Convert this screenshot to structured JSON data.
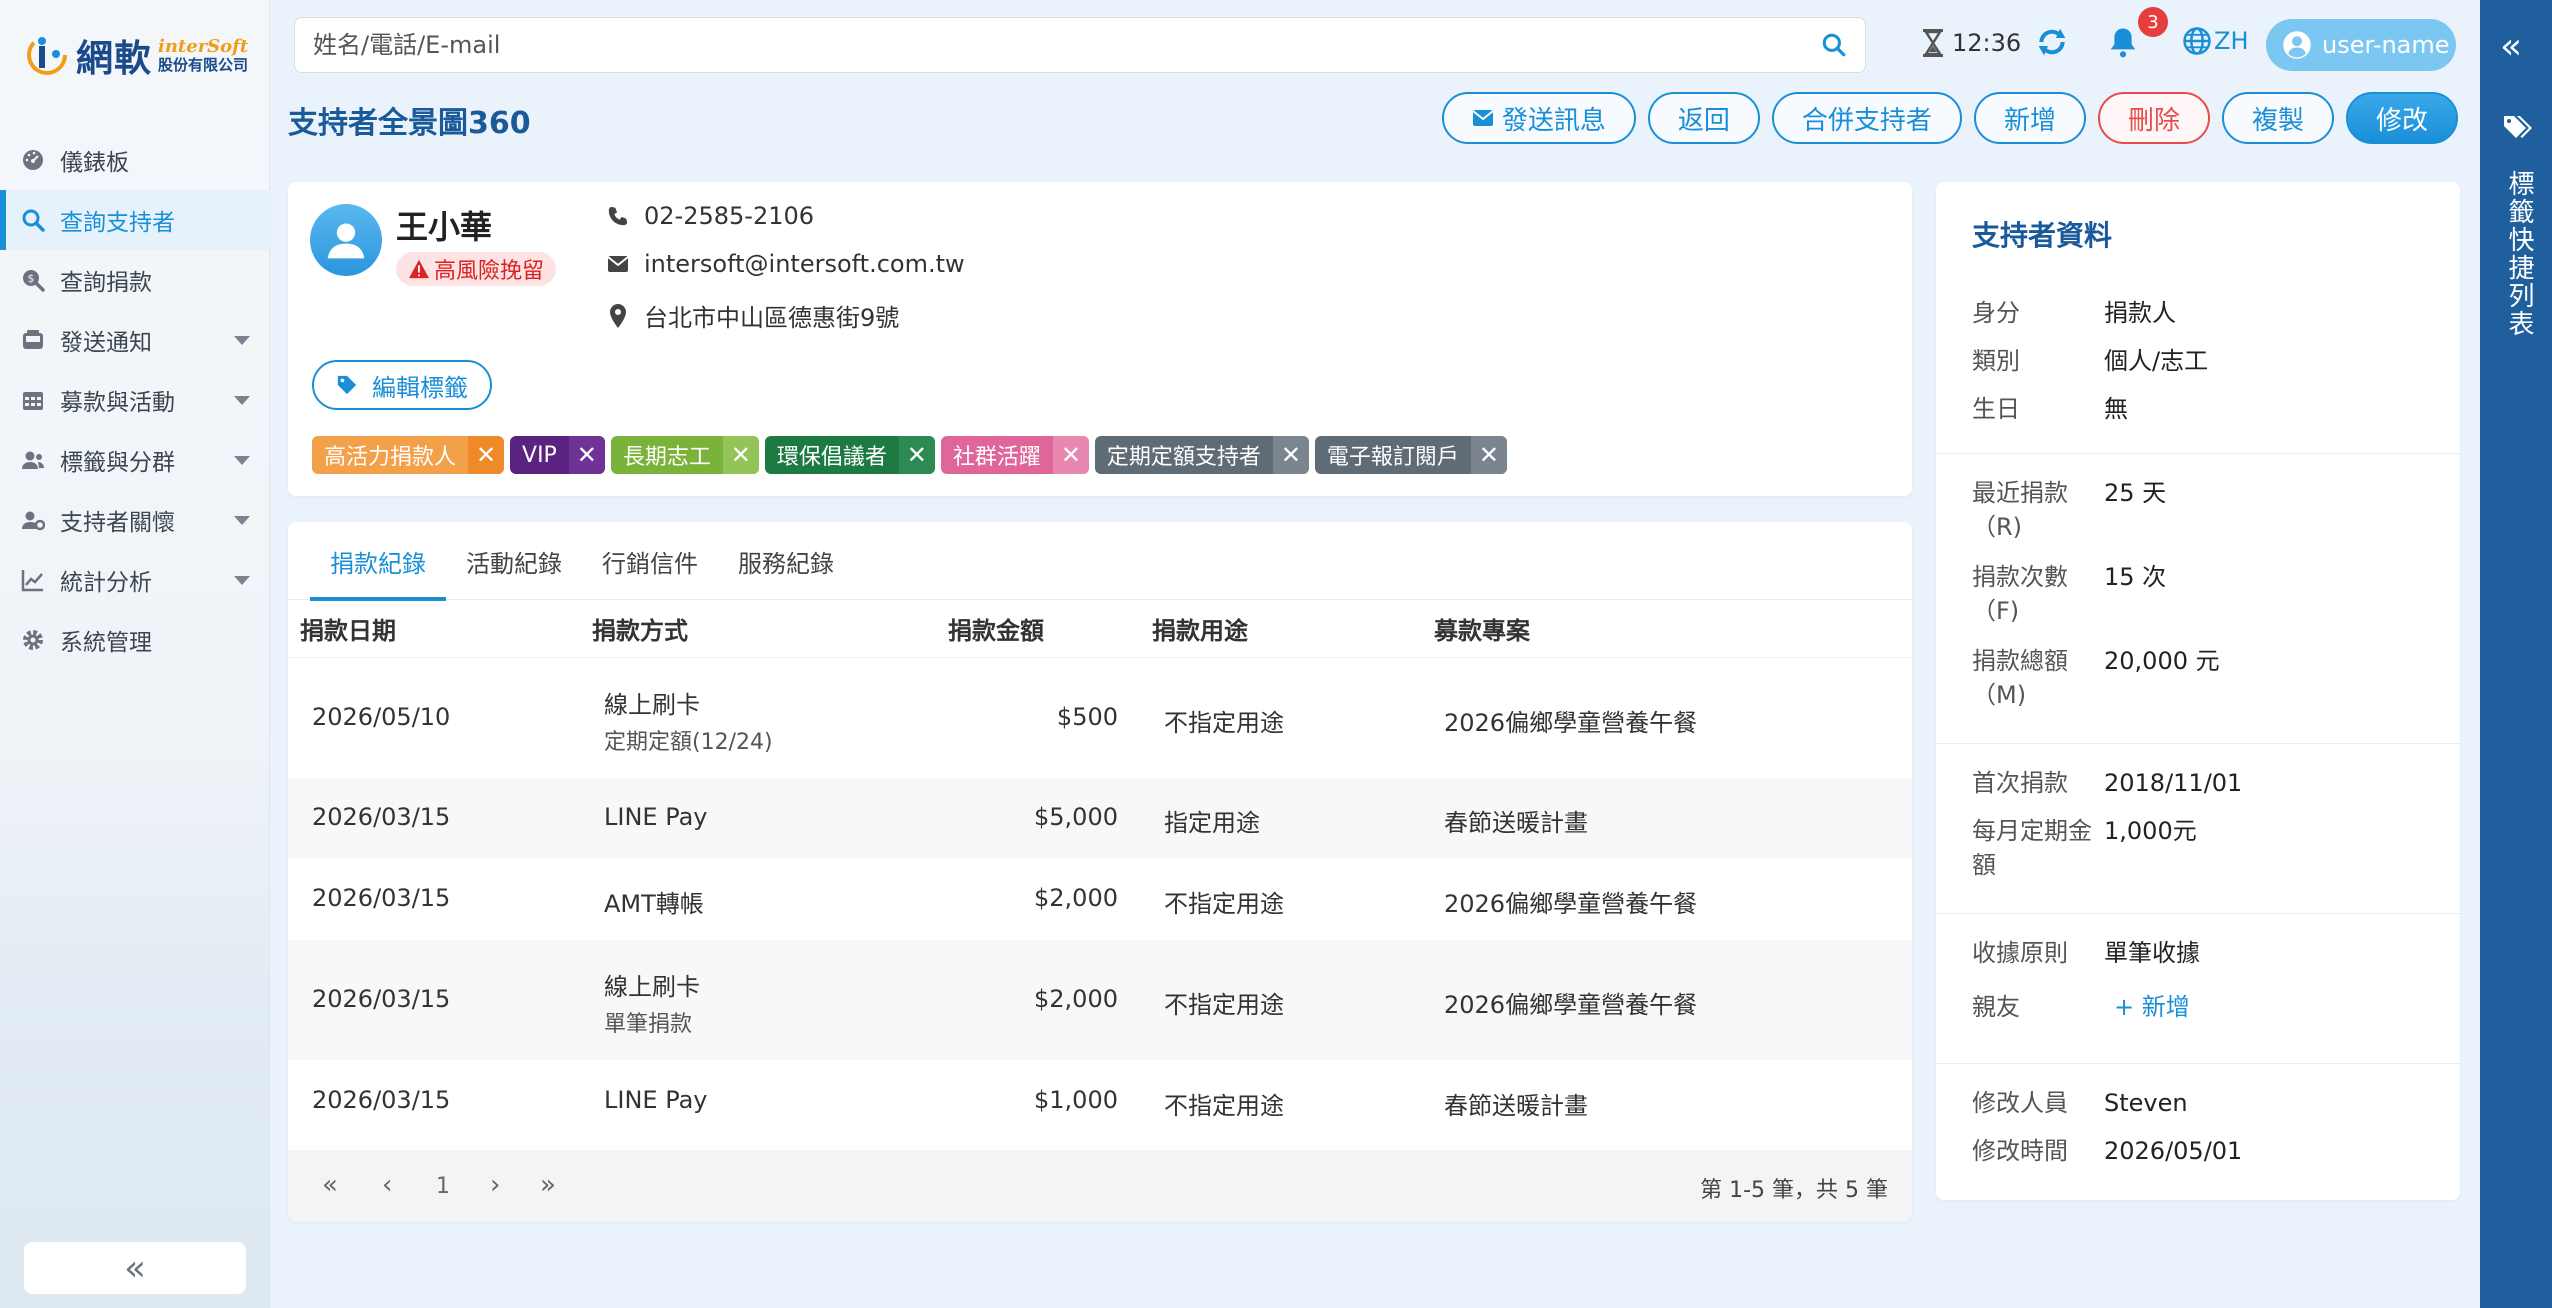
{
  "brand": {
    "name": "網軟",
    "en": "interSoft",
    "company": "股份有限公司"
  },
  "sidebar": {
    "items": [
      {
        "label": "儀錶板",
        "icon": "dashboard-icon",
        "caret": false
      },
      {
        "label": "查詢支持者",
        "icon": "search-icon",
        "caret": false,
        "active": true
      },
      {
        "label": "查詢捐款",
        "icon": "search-donation-icon",
        "caret": false
      },
      {
        "label": "發送通知",
        "icon": "inbox-icon",
        "caret": true
      },
      {
        "label": "募款與活動",
        "icon": "calendar-icon",
        "caret": true
      },
      {
        "label": "標籤與分群",
        "icon": "users-icon",
        "caret": true
      },
      {
        "label": "支持者關懷",
        "icon": "user-gear-icon",
        "caret": true
      },
      {
        "label": "統計分析",
        "icon": "chart-line-icon",
        "caret": true
      },
      {
        "label": "系統管理",
        "icon": "gear-icon",
        "caret": false
      }
    ],
    "collapse_label": "«"
  },
  "topbar": {
    "search_placeholder": "姓名/電話/E-mail",
    "timer": "12:36",
    "notification_count": "3",
    "lang": "ZH",
    "user": "user-name"
  },
  "right_strip": {
    "label": "標籤快捷列表"
  },
  "page": {
    "title": "支持者全景圖360"
  },
  "actions": {
    "send": "發送訊息",
    "back": "返回",
    "merge": "合併支持者",
    "add": "新增",
    "delete": "刪除",
    "copy": "複製",
    "edit": "修改"
  },
  "profile": {
    "name": "王小華",
    "risk": "高風險挽留",
    "phone": "02-2585-2106",
    "email": "intersoft@intersoft.com.tw",
    "address": "台北市中山區德惠街9號",
    "edit_tags": "編輯標籤",
    "tags": [
      {
        "label": "高活力捐款人",
        "color": "#f2a14a",
        "xcolor": "#ef8a2a"
      },
      {
        "label": "VIP",
        "color": "#5a2380",
        "xcolor": "#6e3394"
      },
      {
        "label": "長期志工",
        "color": "#7bb33a",
        "xcolor": "#92c457"
      },
      {
        "label": "環保倡議者",
        "color": "#1e7a43",
        "xcolor": "#2c8a52"
      },
      {
        "label": "社群活躍",
        "color": "#e0669a",
        "xcolor": "#e888b0"
      },
      {
        "label": "定期定額支持者",
        "color": "#5f6b75",
        "xcolor": "#7a858f"
      },
      {
        "label": "電子報訂閱戶",
        "color": "#5f6b75",
        "xcolor": "#7a858f"
      }
    ]
  },
  "tabs": [
    "捐款紀錄",
    "活動紀錄",
    "行銷信件",
    "服務紀錄"
  ],
  "table": {
    "headers": [
      "捐款日期",
      "捐款方式",
      "捐款金額",
      "捐款用途",
      "募款專案"
    ],
    "rows": [
      {
        "date": "2026/05/10",
        "method": "線上刷卡",
        "method_sub": "定期定額(12/24)",
        "amount": "$500",
        "purpose": "不指定用途",
        "project": "2026偏鄉學童營養午餐"
      },
      {
        "date": "2026/03/15",
        "method": "LINE Pay",
        "method_sub": "",
        "amount": "$5,000",
        "purpose": "指定用途",
        "project": "春節送暖計畫"
      },
      {
        "date": "2026/03/15",
        "method": "AMT轉帳",
        "method_sub": "",
        "amount": "$2,000",
        "purpose": "不指定用途",
        "project": "2026偏鄉學童營養午餐"
      },
      {
        "date": "2026/03/15",
        "method": "線上刷卡",
        "method_sub": "單筆捐款",
        "amount": "$2,000",
        "purpose": "不指定用途",
        "project": "2026偏鄉學童營養午餐"
      },
      {
        "date": "2026/03/15",
        "method": "LINE Pay",
        "method_sub": "",
        "amount": "$1,000",
        "purpose": "不指定用途",
        "project": "春節送暖計畫"
      }
    ],
    "page": "1",
    "page_info": "第 1-5 筆，共 5 筆"
  },
  "info": {
    "title": "支持者資料",
    "identity_k": "身分",
    "identity_v": "捐款人",
    "type_k": "類別",
    "type_v": "個人/志工",
    "birthday_k": "生日",
    "birthday_v": "無",
    "recency_k": "最近捐款（R)",
    "recency_v": "25 天",
    "frequency_k": "捐款次數（F)",
    "frequency_v": "15 次",
    "monetary_k": "捐款總額（M)",
    "monetary_v": "20,000 元",
    "first_k": "首次捐款",
    "first_v": "2018/11/01",
    "monthly_k": "每月定期金額",
    "monthly_v": "1,000元",
    "receipt_k": "收據原則",
    "receipt_v": "單筆收據",
    "relatives_k": "親友",
    "relatives_v": "+ 新增",
    "modifier_k": "修改人員",
    "modifier_v": "Steven",
    "modified_k": "修改時間",
    "modified_v": "2026/05/01"
  }
}
